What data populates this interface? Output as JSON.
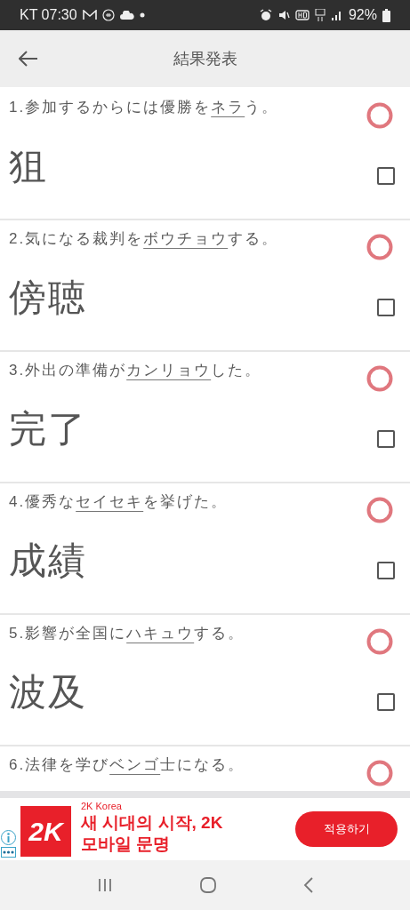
{
  "status_bar": {
    "carrier_time": "KT 07:30",
    "battery": "92%"
  },
  "header": {
    "title": "結果発表"
  },
  "questions": [
    {
      "number": "1.",
      "before": "参加するからには優勝を",
      "underlined": "ネラ",
      "after": "う。",
      "answer": "狙",
      "kind": "correct",
      "checked": false
    },
    {
      "number": "2.",
      "before": "気になる裁判を",
      "underlined": "ボウチョウ",
      "after": "する。",
      "answer": "傍聴",
      "kind": "correct",
      "checked": false
    },
    {
      "number": "3.",
      "before": "外出の準備が",
      "underlined": "カンリョウ",
      "after": "した。",
      "answer": "完了",
      "kind": "correct",
      "checked": false
    },
    {
      "number": "4.",
      "before": "優秀な",
      "underlined": "セイセキ",
      "after": "を挙げた。",
      "answer": "成績",
      "kind": "correct",
      "checked": false
    },
    {
      "number": "5.",
      "before": "影響が全国に",
      "underlined": "ハキュウ",
      "after": "する。",
      "answer": "波及",
      "kind": "correct",
      "checked": false
    },
    {
      "number": "6.",
      "before": "法律を学び",
      "underlined": "ベンゴ",
      "after": "士になる。",
      "kind": "correct"
    }
  ],
  "ad": {
    "logo": "2K",
    "advertiser": "2K Korea",
    "headline": "새 시대의 시작, 2K 모바일 문명",
    "button": "적용하기"
  }
}
